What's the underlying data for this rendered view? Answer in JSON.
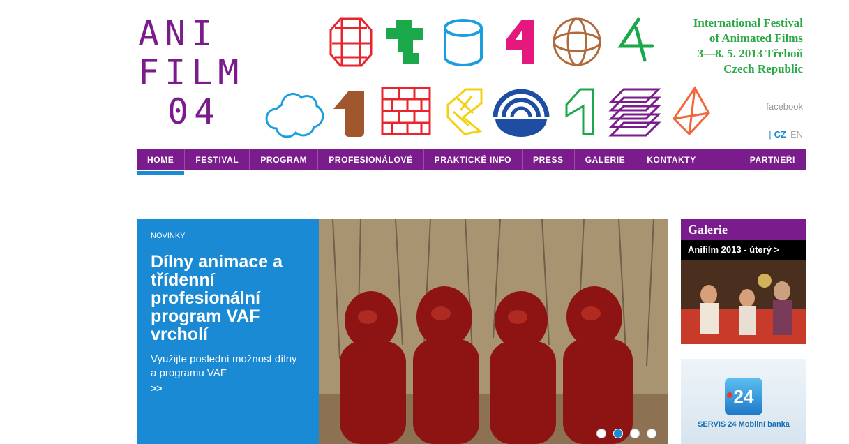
{
  "logo": {
    "line1": "ANI",
    "line2": "FILM",
    "line3": "04"
  },
  "festival": {
    "line1": "International Festival",
    "line2": "of Animated Films",
    "line3": "3—8. 5. 2013 Třeboň",
    "line4": "Czech Republic"
  },
  "social": {
    "facebook": "facebook"
  },
  "language": {
    "separator": "|",
    "cz": "CZ",
    "en": "EN"
  },
  "nav": {
    "items": [
      "HOME",
      "FESTIVAL",
      "PROGRAM",
      "PROFESIONÁLOVÉ",
      "PRAKTICKÉ INFO",
      "PRESS",
      "GALERIE",
      "KONTAKTY"
    ],
    "right": "PARTNEŘI"
  },
  "hero": {
    "kicker": "NOVINKY",
    "title": "Dílny animace a třídenní profesionální program VAF vrcholí",
    "description": "Využijte poslední možnost dílny a programu VAF",
    "more": ">>",
    "active_slide": 2,
    "slide_count": 4
  },
  "gallery": {
    "heading": "Galerie",
    "caption": "Anifilm 2013 - úterý >"
  },
  "ad": {
    "badge": "24",
    "text": "SERVIS 24 Mobilní banka"
  },
  "colors": {
    "purple": "#7a1c8b",
    "blue": "#1a8ad4",
    "green": "#2aa845"
  }
}
